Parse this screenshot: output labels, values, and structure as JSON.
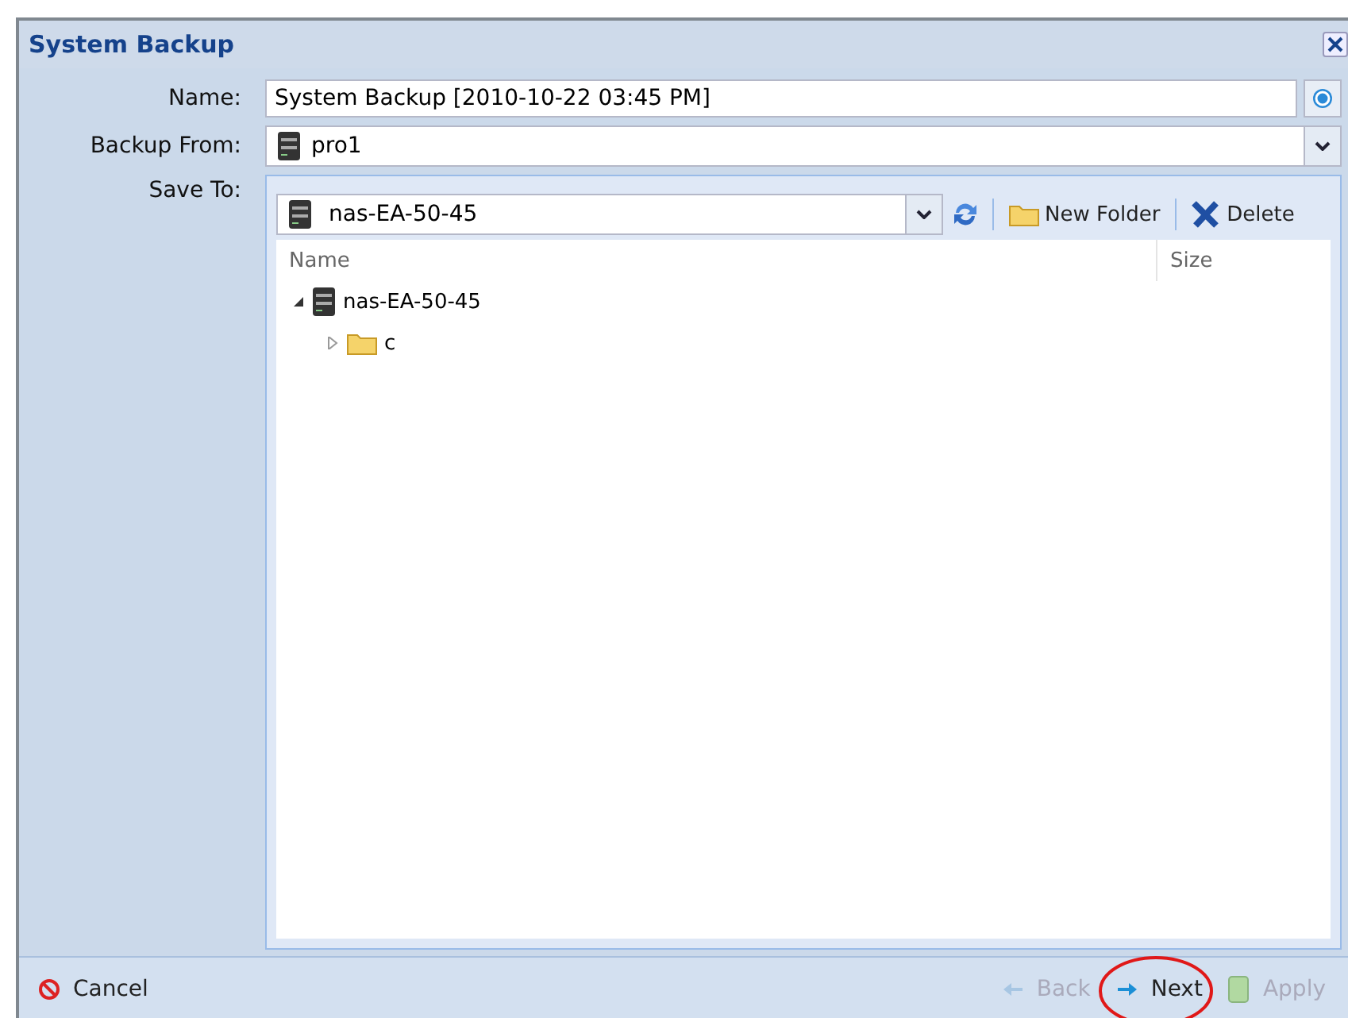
{
  "window": {
    "title": "System Backup"
  },
  "fields": [
    {
      "kind": "text",
      "label": "Name:",
      "value": "System Backup [2010-10-22 03:45 PM]"
    },
    {
      "kind": "select",
      "label": "Backup From:",
      "value": "pro1"
    }
  ],
  "save_to": {
    "label": "Save To:",
    "location": "nas-EA-50-45",
    "toolbar": [
      {
        "kind": "refresh"
      },
      {
        "kind": "folder",
        "label": "New Folder"
      },
      {
        "kind": "delete",
        "label": "Delete"
      }
    ],
    "columns": [
      "Name",
      "Size"
    ],
    "tree": [
      {
        "label": "nas-EA-50-45",
        "kind": "server",
        "expanded": true,
        "children": [
          {
            "label": "c",
            "kind": "folder",
            "expanded": false
          }
        ]
      }
    ]
  },
  "footer": {
    "cancel": "Cancel",
    "buttons": [
      {
        "kind": "back",
        "label": "Back",
        "disabled": true,
        "highlighted": false
      },
      {
        "kind": "next",
        "label": "Next",
        "disabled": false,
        "highlighted": true
      },
      {
        "kind": "apply",
        "label": "Apply",
        "disabled": true,
        "highlighted": false
      }
    ]
  }
}
